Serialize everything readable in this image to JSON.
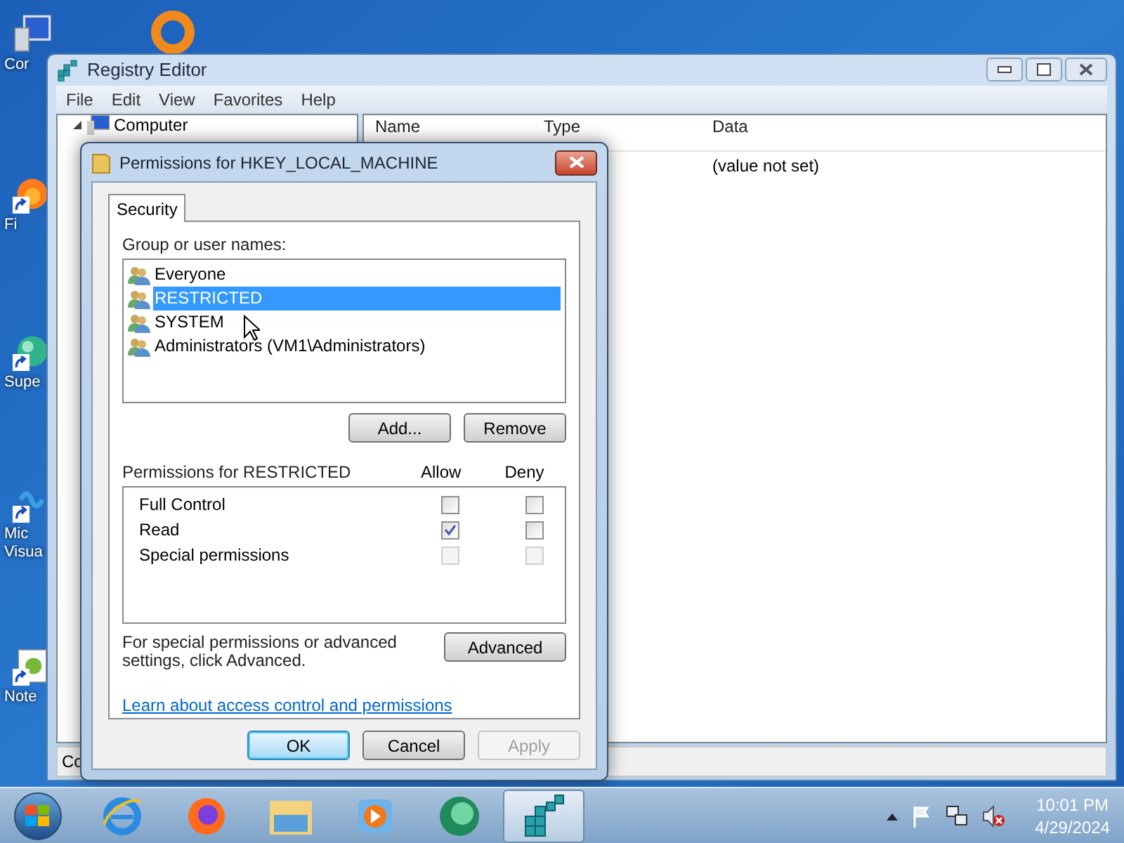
{
  "desktop_icons": [
    {
      "kind": "computer",
      "label": "Cor"
    },
    {
      "kind": "ring"
    },
    {
      "kind": "browser",
      "label": "Fi"
    },
    {
      "kind": "globe",
      "label": "Supe"
    },
    {
      "kind": "studio",
      "label": "Mic\nVisua"
    },
    {
      "kind": "notepad",
      "label": "Note"
    }
  ],
  "registry_editor": {
    "title": "Registry Editor",
    "menu": [
      "File",
      "Edit",
      "View",
      "Favorites",
      "Help"
    ],
    "tree": [
      {
        "label": "Computer",
        "expanded": true
      }
    ],
    "columns": [
      "Name",
      "Type",
      "Data"
    ],
    "rows": [
      {
        "data": "(value not set)"
      }
    ],
    "status_bar": "Co"
  },
  "dialog": {
    "title": "Permissions for HKEY_LOCAL_MACHINE",
    "tabs": [
      {
        "label": "Security",
        "selected": true
      }
    ],
    "group_label": "Group or user names:",
    "users": [
      {
        "name": "Everyone",
        "selected": false
      },
      {
        "name": "RESTRICTED",
        "selected": true
      },
      {
        "name": "SYSTEM",
        "selected": false
      },
      {
        "name": "Administrators (VM1\\Administrators)",
        "selected": false
      }
    ],
    "user_buttons": [
      "Add...",
      "Remove"
    ],
    "permissions_label": "Permissions for RESTRICTED",
    "allow_label": "Allow",
    "deny_label": "Deny",
    "permissions": [
      {
        "name": "Full Control",
        "allow": {
          "checked": false,
          "disabled": false
        },
        "deny": {
          "checked": false,
          "disabled": false
        }
      },
      {
        "name": "Read",
        "allow": {
          "checked": true,
          "disabled": false
        },
        "deny": {
          "checked": false,
          "disabled": false
        }
      },
      {
        "name": "Special permissions",
        "allow": {
          "checked": false,
          "disabled": true
        },
        "deny": {
          "checked": false,
          "disabled": true
        }
      }
    ],
    "advanced_note": "For special permissions or advanced settings, click Advanced.",
    "advanced_button": "Advanced",
    "link": "Learn about access control and permissions",
    "buttons": [
      {
        "label": "OK",
        "default": true,
        "disabled": false
      },
      {
        "label": "Cancel",
        "default": false,
        "disabled": false
      },
      {
        "label": "Apply",
        "default": false,
        "disabled": true
      }
    ]
  },
  "taskbar": {
    "items": [
      {
        "kind": "ie",
        "active": false
      },
      {
        "kind": "firefox",
        "active": false
      },
      {
        "kind": "explorer",
        "active": false
      },
      {
        "kind": "media",
        "active": false
      },
      {
        "kind": "green",
        "active": false
      },
      {
        "kind": "regedit",
        "active": true
      }
    ],
    "time": "10:01 PM",
    "date": "4/29/2024"
  }
}
